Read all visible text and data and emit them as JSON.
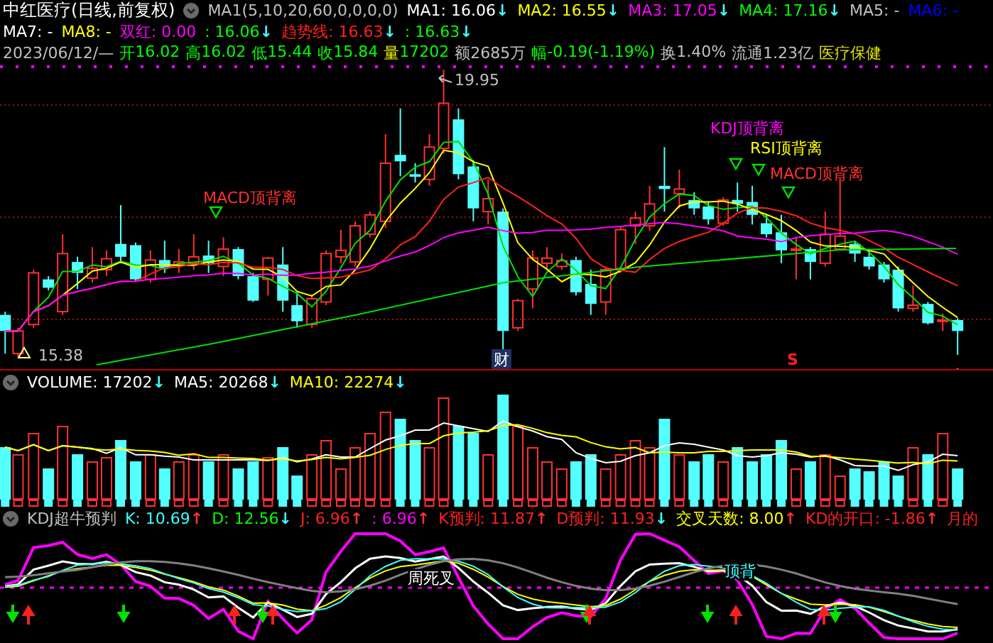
{
  "title": "中红医疗(日线,前复权)",
  "indicator_params": "MA1(5,10,20,60,0,0,0,0)",
  "ma_legend_row1": [
    {
      "text": "MA1: 16.06",
      "arrow": "↓",
      "rising": false,
      "color": "#ffffff"
    },
    {
      "text": "MA2: 16.55",
      "arrow": "↓",
      "rising": false,
      "color": "#ffff00"
    },
    {
      "text": "MA3: 17.05",
      "arrow": "↓",
      "rising": false,
      "color": "#ff00ff"
    },
    {
      "text": "MA4: 17.16",
      "arrow": "↓",
      "rising": false,
      "color": "#00ff00"
    },
    {
      "text": "MA5: -",
      "color": "#c0c0c0"
    },
    {
      "text": "MA6: -",
      "color": "#0000ff"
    }
  ],
  "ma_legend_row2": [
    {
      "text": "MA7: -",
      "color": "#ffffff"
    },
    {
      "text": "MA8: -",
      "color": "#ffff00"
    },
    {
      "text": "双红: 0.00",
      "color": "#ff00ff"
    },
    {
      "text": ": 16.06",
      "arrow": "↓",
      "rising": false,
      "color": "#00ff00"
    },
    {
      "text": "趋势线: 16.63",
      "arrow": "↓",
      "rising": false,
      "color": "#ff2020"
    },
    {
      "text": ": 16.63",
      "arrow": "↓",
      "rising": false,
      "color": "#00ff00"
    }
  ],
  "quote": [
    {
      "label": {
        "text": "2023/06/12/—",
        "color": "#c0c0c0"
      }
    },
    {
      "label": {
        "text": "开",
        "color": "#00ff00"
      },
      "value": {
        "text": "16.02",
        "color": "#00ff00"
      }
    },
    {
      "label": {
        "text": "高",
        "color": "#00ff00"
      },
      "value": {
        "text": "16.02",
        "color": "#00ff00"
      }
    },
    {
      "label": {
        "text": "低",
        "color": "#00ff00"
      },
      "value": {
        "text": "15.44",
        "color": "#00ff00"
      }
    },
    {
      "label": {
        "text": "收",
        "color": "#00ff00"
      },
      "value": {
        "text": "15.84",
        "color": "#00ff00"
      }
    },
    {
      "label": {
        "text": "量",
        "color": "#ffff00"
      },
      "value": {
        "text": "17202",
        "color": "#00ff00"
      }
    },
    {
      "label": {
        "text": "额",
        "color": "#c0c0c0"
      },
      "value": {
        "text": "2685万",
        "color": "#c0c0c0"
      }
    },
    {
      "label": {
        "text": "幅",
        "color": "#00ff00"
      },
      "value": {
        "text": "-0.19(-1.19%)",
        "color": "#00ff00"
      }
    },
    {
      "label": {
        "text": "换",
        "color": "#c0c0c0"
      },
      "value": {
        "text": "1.40%",
        "color": "#c0c0c0"
      }
    },
    {
      "label": {
        "text": "流通",
        "color": "#c0c0c0"
      },
      "value": {
        "text": "1.23亿",
        "color": "#c0c0c0"
      }
    },
    {
      "label": {
        "text": "医疗保健",
        "color": "#e0e000"
      }
    }
  ],
  "chart_labels": [
    {
      "kind": "high",
      "text": "19.95",
      "color": "#c0c0c0"
    },
    {
      "kind": "low",
      "text": "15.38",
      "color": "#c0c0c0"
    },
    {
      "kind": "signal",
      "text": "MACD顶背离",
      "color": "#ff3030"
    },
    {
      "kind": "signal",
      "text": "KDJ顶背离",
      "color": "#ff00ff"
    },
    {
      "kind": "signal",
      "text": "RSI顶背离",
      "color": "#ffff00"
    },
    {
      "kind": "signal",
      "text": "MACD顶背离",
      "color": "#ff3030"
    },
    {
      "kind": "event",
      "text": "财",
      "color": "#ffffff"
    },
    {
      "kind": "sell",
      "text": "S",
      "color": "#ff2020"
    }
  ],
  "volume_legend": [
    {
      "text": "VOLUME: 17202",
      "arrow": "↓",
      "rising": false,
      "color": "#ffffff"
    },
    {
      "text": "MA5: 20268",
      "arrow": "↓",
      "rising": false,
      "color": "#ffffff"
    },
    {
      "text": "MA10: 22274",
      "arrow": "↓",
      "rising": false,
      "color": "#ffff00"
    }
  ],
  "kdj_title": "KDJ超牛预判",
  "kdj_legend": [
    {
      "text": "K: 10.69",
      "arrow": "↑",
      "rising": true,
      "color": "#40ffff"
    },
    {
      "text": "D: 12.56",
      "arrow": "↓",
      "rising": false,
      "color": "#00ff00"
    },
    {
      "text": "J: 6.96",
      "arrow": "↑",
      "rising": true,
      "color": "#ff2020"
    },
    {
      "text": ": 6.96",
      "arrow": "↑",
      "rising": true,
      "color": "#ff00ff"
    },
    {
      "text": "K预判: 11.87",
      "arrow": "↑",
      "rising": true,
      "color": "#ff2020"
    },
    {
      "text": "D预判: 11.93",
      "arrow": "↓",
      "rising": false,
      "color": "#ff2020"
    },
    {
      "text": "交叉天数: 8.00",
      "arrow": "↑",
      "rising": true,
      "color": "#ffff00"
    },
    {
      "text": "KD的开口: -1.86",
      "arrow": "↑",
      "rising": true,
      "color": "#ff2020"
    },
    {
      "text": "月的",
      "color": "#ff2020"
    }
  ],
  "kdj_labels": [
    {
      "text": "周死叉",
      "color": "#ffffff"
    },
    {
      "text": "顶背",
      "color": "#40ffff"
    }
  ]
}
